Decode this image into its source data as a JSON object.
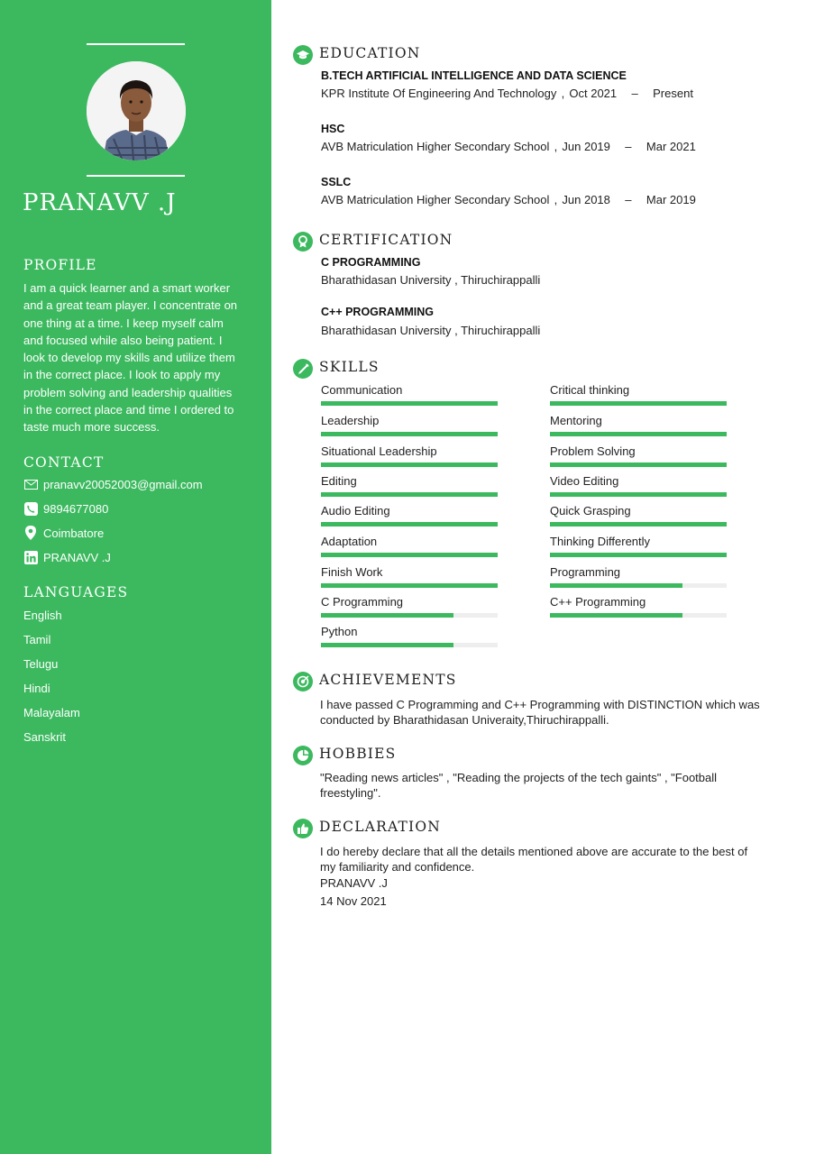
{
  "person": {
    "name": "PRANAVV .J"
  },
  "sidebar": {
    "profile": {
      "heading": "PROFILE",
      "lines": [
        "I am a quick learner and a smart worker",
        "and a great team player. I concentrate on",
        "one thing at a time. I keep myself calm",
        "and focused while also being patient. I",
        "look to develop my skills and utilize them",
        "in the correct place. I look to apply my",
        "problem solving and leadership qualities",
        "in the correct place and time I ordered to",
        "taste much more success."
      ]
    },
    "contact": {
      "heading": "CONTACT",
      "items": [
        {
          "icon": "mail-icon",
          "text": "pranavv20052003@gmail.com"
        },
        {
          "icon": "phone-icon",
          "text": "9894677080"
        },
        {
          "icon": "location-pin-icon",
          "text": "Coimbatore"
        },
        {
          "icon": "linkedin-icon",
          "text": "PRANAVV .J"
        }
      ]
    },
    "languages": {
      "heading": "LANGUAGES",
      "items": [
        "English",
        "Tamil",
        "Telugu",
        "Hindi",
        "Malayalam",
        "Sanskrit"
      ]
    }
  },
  "education": {
    "heading": "EDUCATION",
    "entries": [
      {
        "degree": "B.TECH ARTIFICIAL INTELLIGENCE AND DATA SCIENCE",
        "school": "KPR Institute Of Engineering And Technology",
        "comma": ",",
        "start": "Oct 2021",
        "dash": "–",
        "end": "Present"
      },
      {
        "degree": "HSC",
        "school": "AVB Matriculation Higher Secondary School",
        "comma": ",",
        "start": "Jun 2019",
        "dash": "–",
        "end": "Mar 2021"
      },
      {
        "degree": "SSLC",
        "school": "AVB Matriculation Higher Secondary School",
        "comma": ",",
        "start": "Jun 2018",
        "dash": "–",
        "end": "Mar 2019"
      }
    ]
  },
  "certification": {
    "heading": "CERTIFICATION",
    "entries": [
      {
        "title": "C PROGRAMMING",
        "issuer": "Bharathidasan University , Thiruchirappalli"
      },
      {
        "title": "C++ PROGRAMMING",
        "issuer": "Bharathidasan University , Thiruchirappalli"
      }
    ]
  },
  "skills": {
    "heading": "SKILLS",
    "items": [
      {
        "name": "Communication",
        "level": 1.0
      },
      {
        "name": "Critical thinking",
        "level": 1.0
      },
      {
        "name": "Leadership",
        "level": 1.0
      },
      {
        "name": "Mentoring",
        "level": 1.0
      },
      {
        "name": "Situational Leadership",
        "level": 1.0
      },
      {
        "name": "Problem Solving",
        "level": 1.0
      },
      {
        "name": "Editing",
        "level": 1.0
      },
      {
        "name": "Video Editing",
        "level": 1.0
      },
      {
        "name": "Audio Editing",
        "level": 1.0
      },
      {
        "name": "Quick Grasping",
        "level": 1.0
      },
      {
        "name": "Adaptation",
        "level": 1.0
      },
      {
        "name": "Thinking Differently",
        "level": 1.0
      },
      {
        "name": "Finish Work",
        "level": 1.0
      },
      {
        "name": "Programming",
        "level": 0.75
      },
      {
        "name": "C Programming",
        "level": 0.75
      },
      {
        "name": "C++ Programming",
        "level": 0.75
      },
      {
        "name": "Python",
        "level": 0.75
      }
    ]
  },
  "achievements": {
    "heading": "ACHIEVEMENTS",
    "lines": [
      "I have passed C Programming and C++ Programming with DISTINCTION which was",
      "conducted by Bharathidasan Univeraity,Thiruchirappalli."
    ]
  },
  "hobbies": {
    "heading": "HOBBIES",
    "lines": [
      "\"Reading news articles\" , \"Reading the projects of the tech gaints\" , \"Football",
      "freestyling\"."
    ]
  },
  "declaration": {
    "heading": "DECLARATION",
    "lines": [
      "I do hereby declare that all the details mentioned above are accurate to the best of",
      "my familiarity and confidence."
    ],
    "signature": "PRANAVV .J",
    "date": "14 Nov 2021"
  },
  "colors": {
    "accent": "#3cb95f",
    "bar_track": "#eeeeee"
  }
}
